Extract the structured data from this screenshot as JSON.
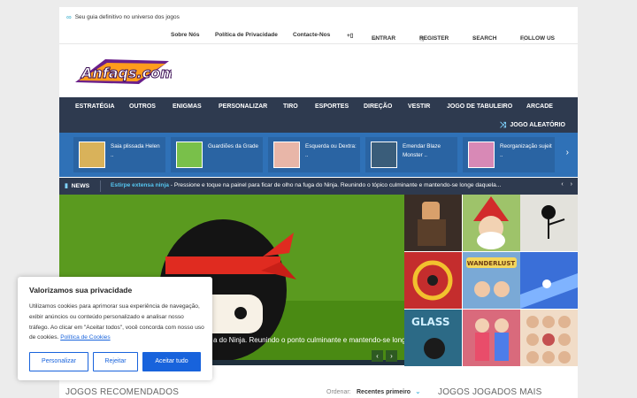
{
  "tagline": "Seu guia definitivo no universo dos jogos",
  "top_links": {
    "about": "Sobre Nós",
    "privacy": "Política de Privacidade",
    "contact": "Contacte-Nos",
    "plus": "+▯",
    "login": "ENTRAR",
    "register": "REGISTER",
    "search": "SEARCH",
    "follow": "FOLLOW US"
  },
  "logo_text": "Anfaqs.com",
  "nav": {
    "items": [
      "ESTRATÉGIA",
      "OUTROS",
      "ENIGMAS",
      "PERSONALIZAR",
      "TIRO",
      "ESPORTES",
      "DIREÇÃO",
      "VESTIR",
      "JOGO DE TABULEIRO",
      "ARCADE"
    ],
    "random": "JOGO ALEATÓRIO"
  },
  "featured": [
    {
      "title": "Saia plissada Helen ..",
      "color": "#d9b25a"
    },
    {
      "title": "Guardiões da Grade",
      "color": "#79c04a"
    },
    {
      "title": "Esquerda ou Dextra: ..",
      "color": "#e8b6a8"
    },
    {
      "title": "Emendar Blaze Monster ..",
      "color": "#3a5d7a"
    },
    {
      "title": "Reorganização sujeit ..",
      "color": "#d889b6"
    }
  ],
  "news": {
    "label": "NEWS",
    "headline": "Estirpe extensa ninja",
    "text": " - Pressione e toque na painel para ficar de olho na fuga do Ninja. Reunindo o tópico culminante e mantendo-se longe daquela..."
  },
  "hero": {
    "caption": "a do Ninja. Reunindo o ponto culminante e mantendo-se longe"
  },
  "tiles": [
    {
      "name": "tile-shooter",
      "color": "#3a2d26"
    },
    {
      "name": "tile-gnome",
      "color": "#9ec36a"
    },
    {
      "name": "tile-stickman",
      "color": "#e3e2dc"
    },
    {
      "name": "tile-ring",
      "color": "#c42d2d"
    },
    {
      "name": "tile-wanderlust",
      "color": "#7aa9d6"
    },
    {
      "name": "tile-blue-road",
      "color": "#3a6fd8"
    },
    {
      "name": "tile-glass",
      "color": "#2c6a86"
    },
    {
      "name": "tile-dressup",
      "color": "#d96a7c"
    },
    {
      "name": "tile-faces",
      "color": "#f1dcc7"
    }
  ],
  "bottom": {
    "recommended": "JOGOS RECOMENDADOS",
    "sort_label": "Ordenar:",
    "sort_value": "Recentes primeiro",
    "most_played": "JOGOS JOGADOS MAIS"
  },
  "cookie": {
    "title": "Valorizamos sua privacidade",
    "body": "Utilizamos cookies para aprimorar sua experiência de navegação, exibir anúncios ou conteúdo personalizado e analisar nosso tráfego. Ao clicar em \"Aceitar todos\", você concorda com nosso uso de cookies. ",
    "policy_link": "Política de Cookies",
    "customize": "Personalizar",
    "reject": "Rejeitar",
    "accept": "Aceitar tudo"
  }
}
